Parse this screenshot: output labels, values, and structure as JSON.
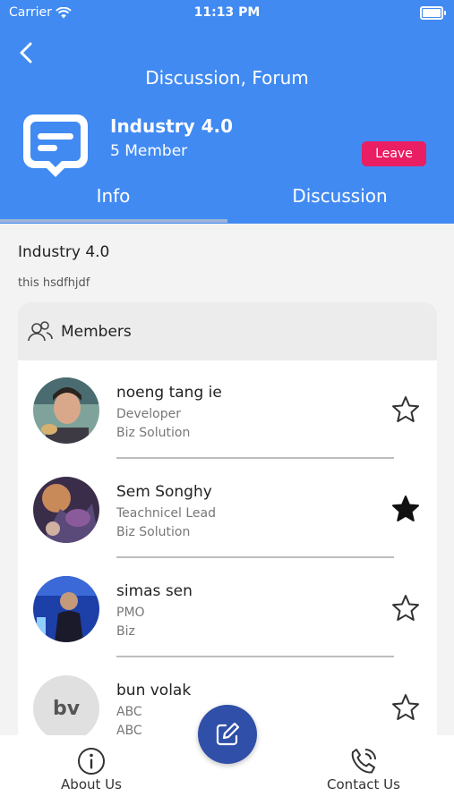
{
  "status_bar": {
    "carrier": "Carrier",
    "time": "11:13 PM"
  },
  "header": {
    "title": "Discussion, Forum",
    "group_name": "Industry 4.0",
    "member_count": "5 Member",
    "leave_label": "Leave",
    "tabs": [
      {
        "label": "Info",
        "active": true
      },
      {
        "label": "Discussion",
        "active": false
      }
    ]
  },
  "info": {
    "title": "Industry 4.0",
    "description": "this hsdfhjdf"
  },
  "members_section": {
    "label": "Members",
    "members": [
      {
        "name": "noeng tang ie",
        "role": "Developer",
        "org": "Biz Solution",
        "starred": false
      },
      {
        "name": "Sem Songhy",
        "role": "Teachnicel Lead",
        "org": "Biz Solution",
        "starred": true
      },
      {
        "name": "simas sen",
        "role": "PMO",
        "org": "Biz",
        "starred": false
      },
      {
        "name": "bun volak",
        "role": "ABC",
        "org": "ABC",
        "starred": false,
        "initials": "bv"
      }
    ]
  },
  "bottom_nav": {
    "about": "About Us",
    "contact": "Contact Us"
  },
  "colors": {
    "header_bg": "#418af2",
    "leave_button": "#e91e63",
    "fab": "#2f4fa8"
  }
}
